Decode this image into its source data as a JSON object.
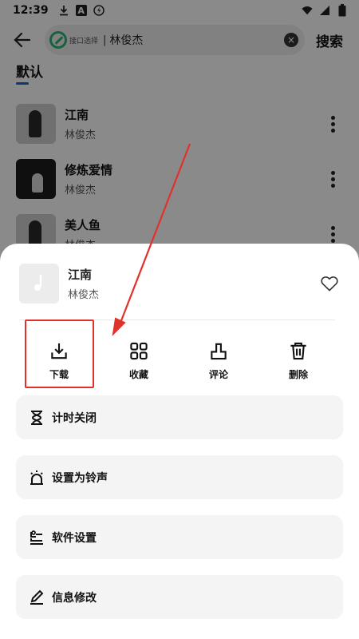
{
  "status_bar": {
    "time": "12:39",
    "left_icons": [
      "download-icon",
      "font-badge-icon",
      "bolt-icon"
    ],
    "right_icons": [
      "wifi-icon",
      "signal-icon",
      "battery-icon"
    ],
    "font_badge": "A"
  },
  "top_bar": {
    "back_icon": "arrow-left-icon",
    "interface_chip": "接口选择",
    "separator": "|",
    "search_value": "林俊杰",
    "search_button": "搜索"
  },
  "tabs": {
    "active": "默认",
    "accent": "#1a67d2"
  },
  "songs": [
    {
      "title": "江南",
      "artist": "林俊杰"
    },
    {
      "title": "修炼爱情",
      "artist": "林俊杰"
    },
    {
      "title": "美人鱼",
      "artist": "林俊杰"
    }
  ],
  "sheet": {
    "song_title": "江南",
    "song_artist": "林俊杰",
    "favorite_icon": "heart-outline-icon",
    "actions": [
      {
        "label": "下载",
        "icon": "download-icon"
      },
      {
        "label": "收藏",
        "icon": "grid-icon"
      },
      {
        "label": "评论",
        "icon": "comment-icon"
      },
      {
        "label": "删除",
        "icon": "trash-icon"
      }
    ],
    "options": [
      {
        "label": "计时关闭",
        "icon": "hourglass-icon"
      },
      {
        "label": "设置为铃声",
        "icon": "alarm-icon"
      },
      {
        "label": "软件设置",
        "icon": "settings-sliders-icon"
      },
      {
        "label": "信息修改",
        "icon": "edit-pen-icon"
      }
    ]
  },
  "annotation": {
    "color": "#e0312a"
  }
}
